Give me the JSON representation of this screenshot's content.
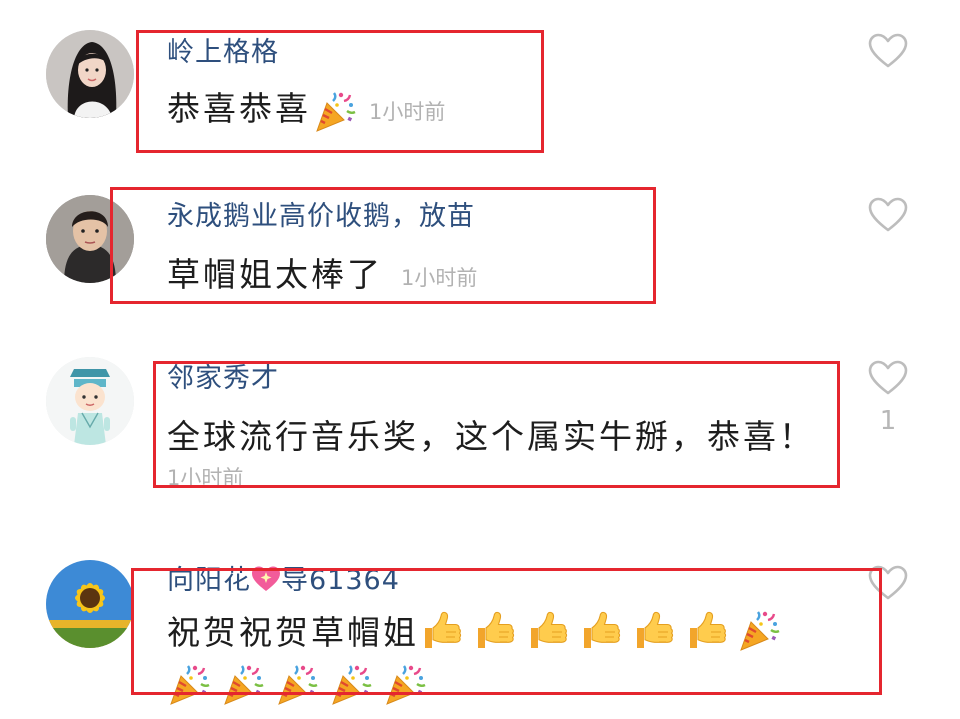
{
  "comments": [
    {
      "username": "岭上格格",
      "text": "恭喜恭喜",
      "time": "1小时前",
      "avatar_icon": "avatar-woman-photo",
      "emoji_after_text": "party-popper",
      "like_count": ""
    },
    {
      "username": "永成鹅业高价收鹅，放苗",
      "text": "草帽姐太棒了",
      "time": "1小时前",
      "avatar_icon": "avatar-man-photo",
      "like_count": ""
    },
    {
      "username": "邻家秀才",
      "text": "全球流行音乐奖，这个属实牛掰，恭喜！",
      "time": "1小时前",
      "avatar_icon": "avatar-scholar-cartoon",
      "like_count": "1"
    },
    {
      "username_prefix": "向阳花",
      "username_suffix": "导61364",
      "username_emoji": "sparkling-heart",
      "text": "祝贺祝贺草帽姐",
      "avatar_icon": "avatar-sunflower-photo",
      "emoji_sequence": [
        "thumbs-up",
        "thumbs-up",
        "thumbs-up",
        "thumbs-up",
        "thumbs-up",
        "thumbs-up",
        "party-popper"
      ],
      "emoji_row2": [
        "party-popper",
        "party-popper",
        "party-popper",
        "party-popper",
        "party-popper"
      ],
      "like_count": ""
    }
  ],
  "icons": {
    "like": "heart-outline-icon"
  },
  "colors": {
    "username": "#2e4f7d",
    "text": "#1d1d1d",
    "time": "#b2b2b2",
    "highlight_border": "#e5262f"
  }
}
